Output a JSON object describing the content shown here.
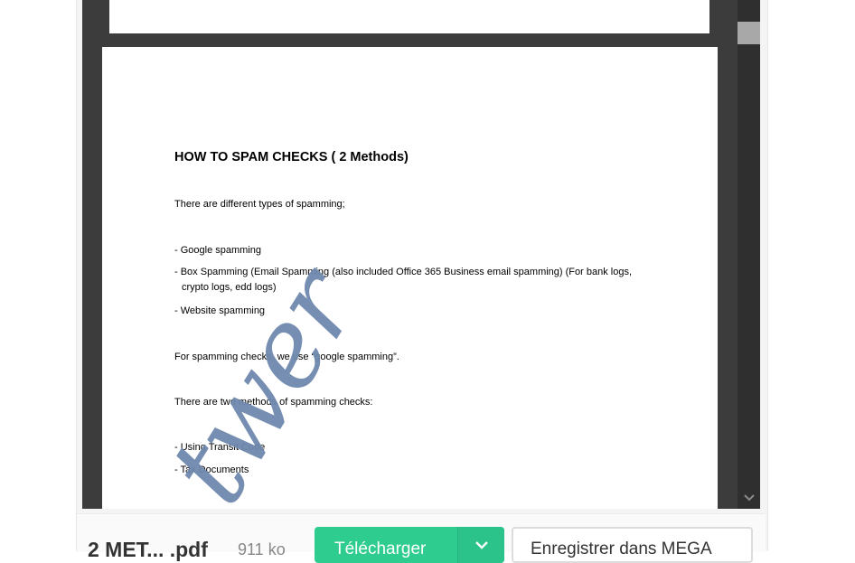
{
  "document": {
    "title": "HOW TO SPAM CHECKS ( 2 Methods)",
    "lines": [
      "There are different types of spamming;",
      "- Google spamming",
      "- Box Spamming (Email Spamming (also included Office 365 Business email spamming) (For bank logs, crypto logs, edd logs)",
      "- Website spamming",
      "For spamming checks, we use “google spamming”.",
      "There are two methods of spamming checks:",
      "- Using Transit Code",
      "- Tax Documents"
    ],
    "watermark": "twer"
  },
  "footer": {
    "file_name": "2 MET... .pdf",
    "file_size": "911 ko",
    "download_label": "Télécharger",
    "save_label": "Enregistrer dans MEGA"
  },
  "colors": {
    "download_green": "#2ecc8e",
    "viewer_bg": "#3c3c3c",
    "watermark": "#6f89ad"
  },
  "icons": {
    "download_dropdown": "chevron-down-icon",
    "scroll_down": "chevron-down-icon"
  }
}
